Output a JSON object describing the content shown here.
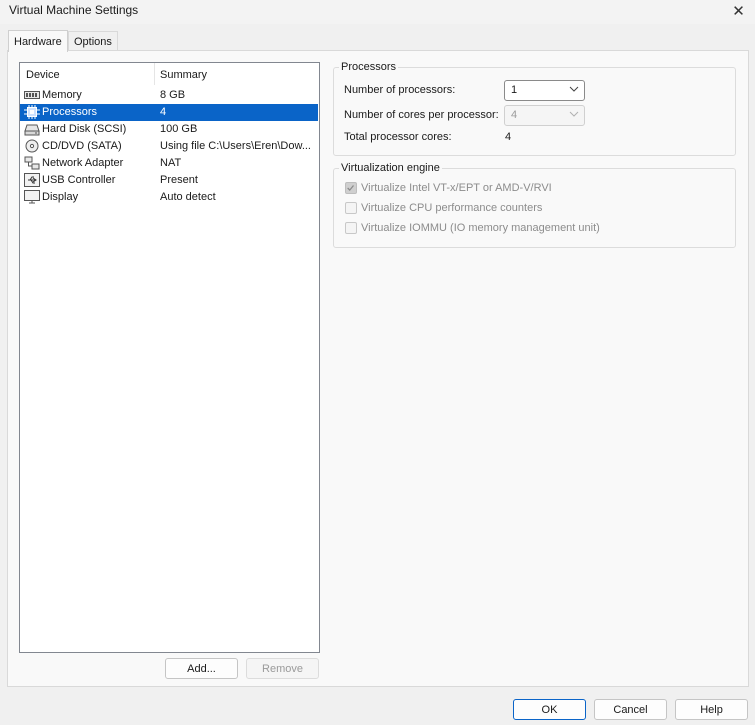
{
  "window": {
    "title": "Virtual Machine Settings",
    "close_glyph": "✕"
  },
  "tabs": [
    {
      "label": "Hardware",
      "active": true
    },
    {
      "label": "Options",
      "active": false
    }
  ],
  "device_table": {
    "headers": {
      "device": "Device",
      "summary": "Summary"
    },
    "rows": [
      {
        "icon": "memory-icon",
        "device": "Memory",
        "summary": "8 GB",
        "selected": false
      },
      {
        "icon": "processor-icon",
        "device": "Processors",
        "summary": "4",
        "selected": true
      },
      {
        "icon": "hard-disk-icon",
        "device": "Hard Disk (SCSI)",
        "summary": "100 GB",
        "selected": false
      },
      {
        "icon": "cd-dvd-icon",
        "device": "CD/DVD (SATA)",
        "summary": "Using file C:\\Users\\Eren\\Dow...",
        "selected": false
      },
      {
        "icon": "network-adapter-icon",
        "device": "Network Adapter",
        "summary": "NAT",
        "selected": false
      },
      {
        "icon": "usb-icon",
        "device": "USB Controller",
        "summary": "Present",
        "selected": false
      },
      {
        "icon": "display-icon",
        "device": "Display",
        "summary": "Auto detect",
        "selected": false
      }
    ]
  },
  "list_buttons": {
    "add": "Add...",
    "remove": "Remove"
  },
  "processors_group": {
    "title": "Processors",
    "num_processors_label": "Number of processors:",
    "num_processors_value": "1",
    "cores_label": "Number of cores per processor:",
    "cores_value": "4",
    "total_label": "Total processor cores:",
    "total_value": "4"
  },
  "virtualization_group": {
    "title": "Virtualization engine",
    "options": [
      {
        "label": "Virtualize Intel VT-x/EPT or AMD-V/RVI",
        "checked": true
      },
      {
        "label": "Virtualize CPU performance counters",
        "checked": false
      },
      {
        "label": "Virtualize IOMMU (IO memory management unit)",
        "checked": false
      }
    ]
  },
  "footer_buttons": {
    "ok": "OK",
    "cancel": "Cancel",
    "help": "Help"
  },
  "colors": {
    "selection": "#0a64c8",
    "default_button_border": "#0a64c8"
  }
}
